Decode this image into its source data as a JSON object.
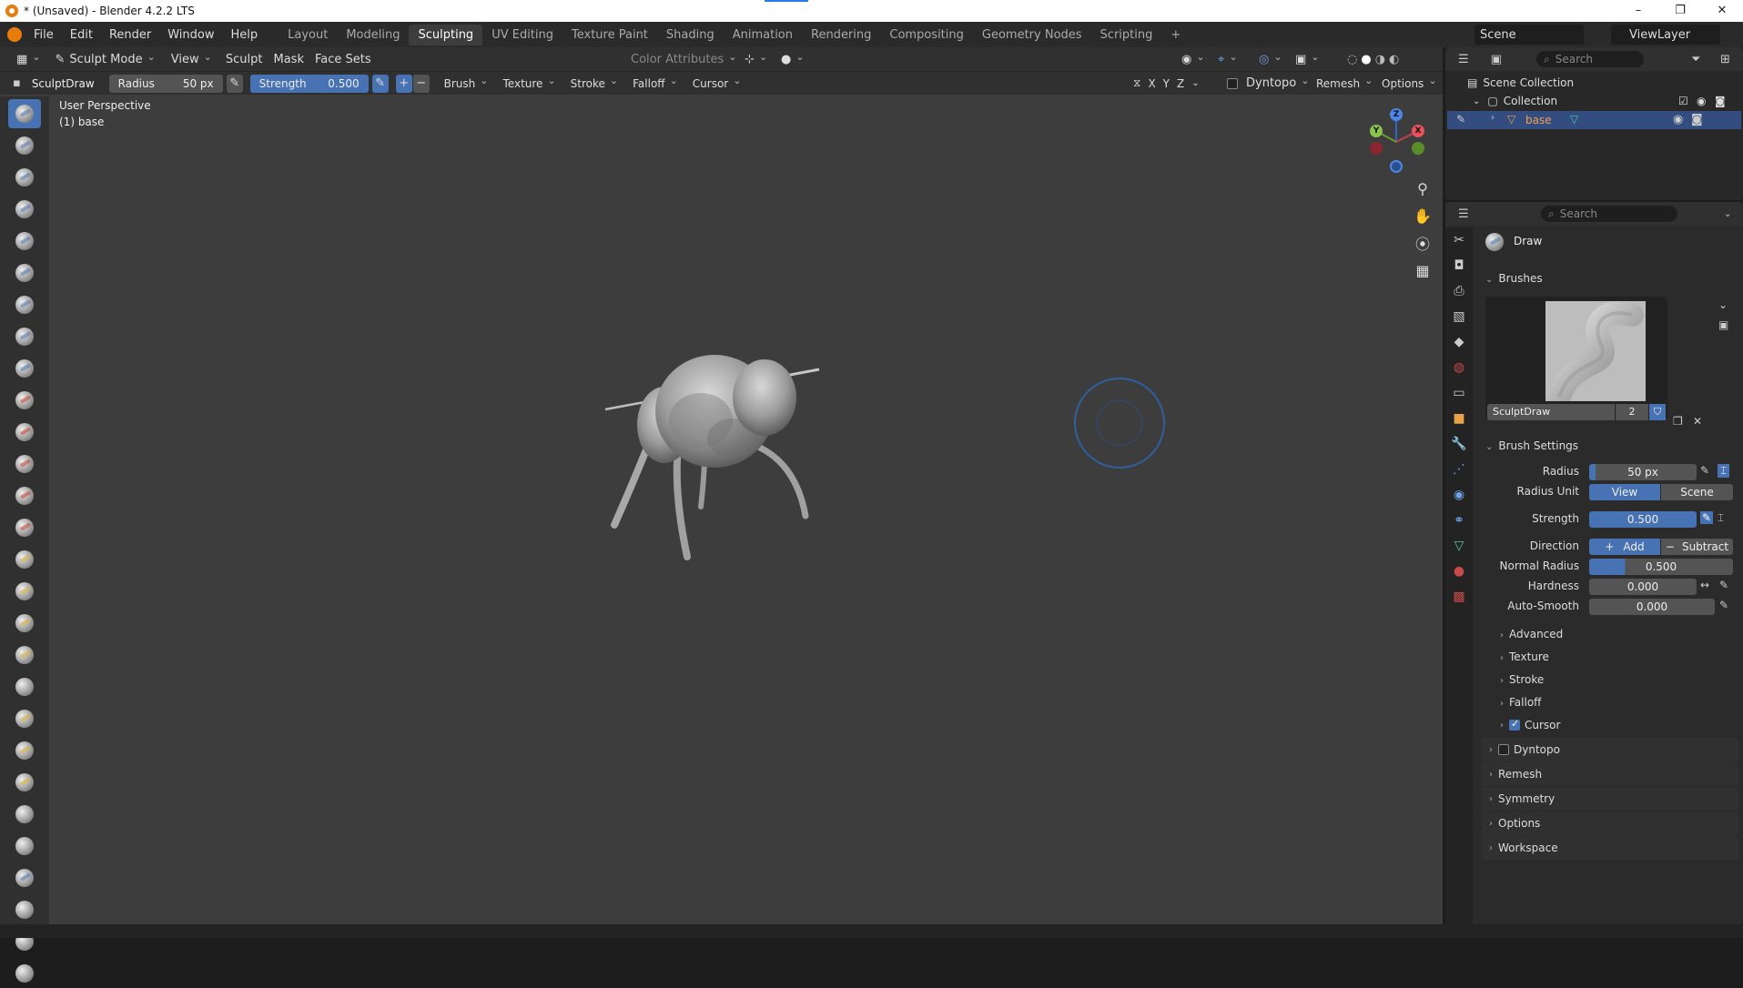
{
  "window": {
    "title": "* (Unsaved) - Blender 4.2.2 LTS",
    "minimize": "–",
    "maximize": "❐",
    "close": "✕"
  },
  "menu": [
    "File",
    "Edit",
    "Render",
    "Window",
    "Help"
  ],
  "workspaces": [
    "Layout",
    "Modeling",
    "Sculpting",
    "UV Editing",
    "Texture Paint",
    "Shading",
    "Animation",
    "Rendering",
    "Compositing",
    "Geometry Nodes",
    "Scripting"
  ],
  "active_workspace": "Sculpting",
  "add_workspace": "+",
  "scene": {
    "label": "Scene",
    "view_layer": "ViewLayer"
  },
  "viewport_header": {
    "mode": "Sculpt Mode",
    "menus": [
      "View",
      "Sculpt",
      "Mask",
      "Face Sets"
    ],
    "color_attributes": "Color Attributes"
  },
  "tool_header": {
    "brush_name": "SculptDraw",
    "radius_label": "Radius",
    "radius_value": "50 px",
    "strength_label": "Strength",
    "strength_value": "0.500",
    "plus": "+",
    "minus": "−",
    "menus": [
      "Brush",
      "Texture",
      "Stroke",
      "Falloff",
      "Cursor"
    ],
    "axes": [
      "X",
      "Y",
      "Z"
    ],
    "dyntopo": "Dyntopo",
    "remesh": "Remesh",
    "options": "Options"
  },
  "viewport": {
    "perspective": "User Perspective",
    "object": "(1) base"
  },
  "gizmo": {
    "x": "X",
    "y": "Y",
    "z": "Z"
  },
  "outliner": {
    "search_placeholder": "Search",
    "scene_collection": "Scene Collection",
    "collection": "Collection",
    "object": "base"
  },
  "properties": {
    "search_placeholder": "Search",
    "tool_name": "Draw",
    "brushes_header": "Brushes",
    "brush_name": "SculptDraw",
    "brush_users": "2",
    "brush_settings_header": "Brush Settings",
    "radius_label": "Radius",
    "radius_value": "50 px",
    "radius_unit_label": "Radius Unit",
    "radius_unit_view": "View",
    "radius_unit_scene": "Scene",
    "strength_label": "Strength",
    "strength_value": "0.500",
    "direction_label": "Direction",
    "direction_add": "Add",
    "direction_subtract": "Subtract",
    "normal_radius_label": "Normal Radius",
    "normal_radius_value": "0.500",
    "hardness_label": "Hardness",
    "hardness_value": "0.000",
    "autosmooth_label": "Auto-Smooth",
    "autosmooth_value": "0.000",
    "subsections": [
      "Advanced",
      "Texture",
      "Stroke",
      "Falloff"
    ],
    "cursor_sub": "Cursor",
    "panels": [
      "Remesh",
      "Symmetry",
      "Options",
      "Workspace"
    ],
    "dyntopo_panel": "Dyntopo"
  },
  "colors": {
    "accent": "#4772b3",
    "viewport_bg": "#3d3d3d",
    "brand": "#e87d0d"
  }
}
